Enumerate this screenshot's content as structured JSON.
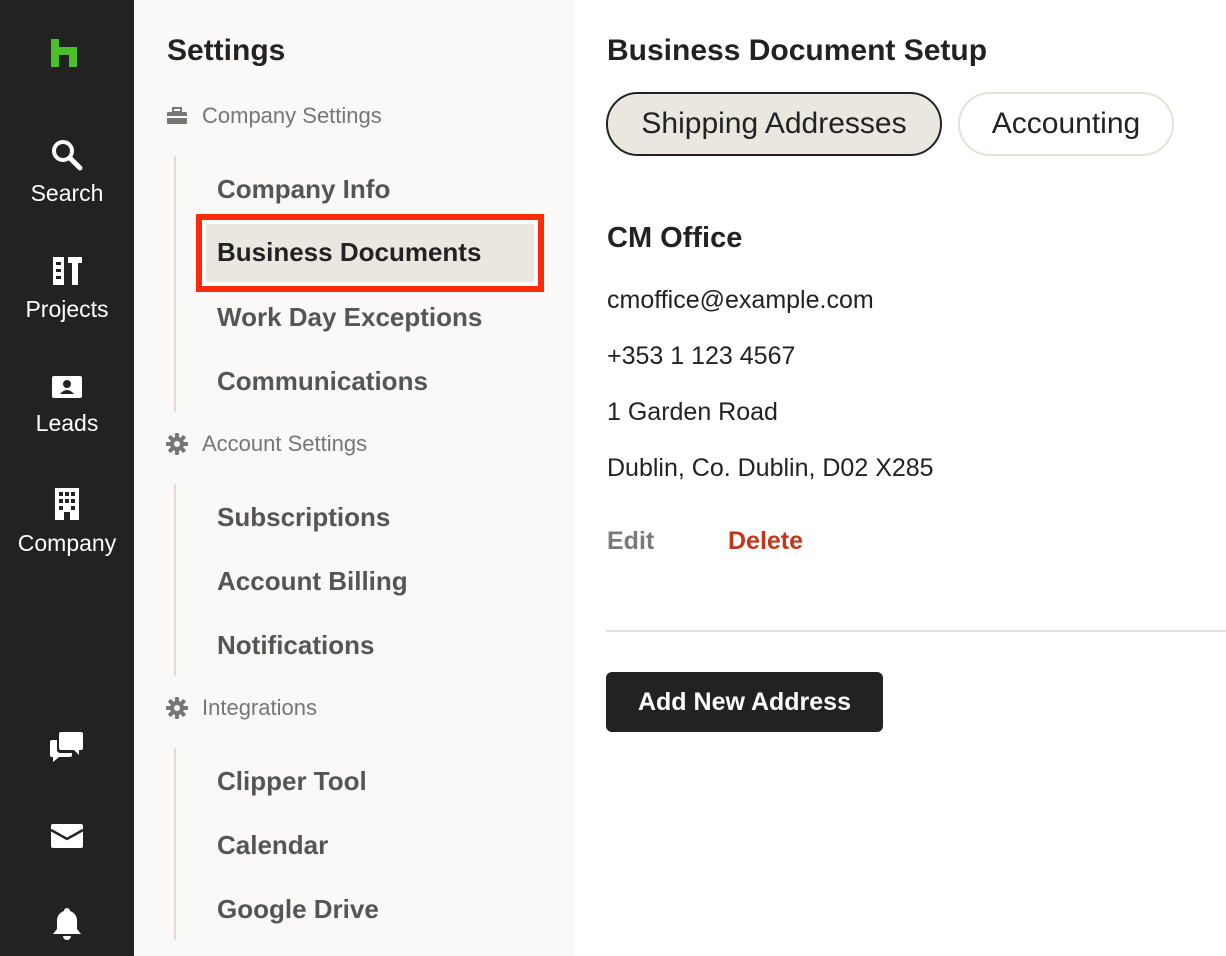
{
  "rail": {
    "brand_color": "#4bbf2a",
    "items": [
      {
        "label": "Search",
        "icon": "search-icon"
      },
      {
        "label": "Projects",
        "icon": "projects-icon"
      },
      {
        "label": "Leads",
        "icon": "leads-icon"
      },
      {
        "label": "Company",
        "icon": "company-icon"
      }
    ],
    "bottom_icons": [
      "chat-icon",
      "inbox-icon",
      "bell-icon"
    ]
  },
  "settings": {
    "title": "Settings",
    "sections": [
      {
        "label": "Company Settings",
        "icon": "briefcase-icon",
        "items": [
          "Company Info",
          "Business Documents",
          "Work Day Exceptions",
          "Communications"
        ]
      },
      {
        "label": "Account Settings",
        "icon": "gear-icon",
        "items": [
          "Subscriptions",
          "Account Billing",
          "Notifications"
        ]
      },
      {
        "label": "Integrations",
        "icon": "gear-icon",
        "items": [
          "Clipper Tool",
          "Calendar",
          "Google Drive"
        ]
      }
    ],
    "active_item": "Business Documents",
    "highlight_color": "#ff2a0a"
  },
  "main": {
    "title": "Business Document Setup",
    "tabs": [
      {
        "label": "Shipping Addresses",
        "selected": true
      },
      {
        "label": "Accounting",
        "selected": false
      }
    ],
    "address": {
      "name": "CM Office",
      "email": "cmoffice@example.com",
      "phone": "+353 1 123 4567",
      "street": "1 Garden Road",
      "city_line": "Dublin, Co. Dublin, D02 X285"
    },
    "edit_label": "Edit",
    "delete_label": "Delete",
    "delete_color": "#c4361c",
    "add_button_label": "Add New Address"
  }
}
